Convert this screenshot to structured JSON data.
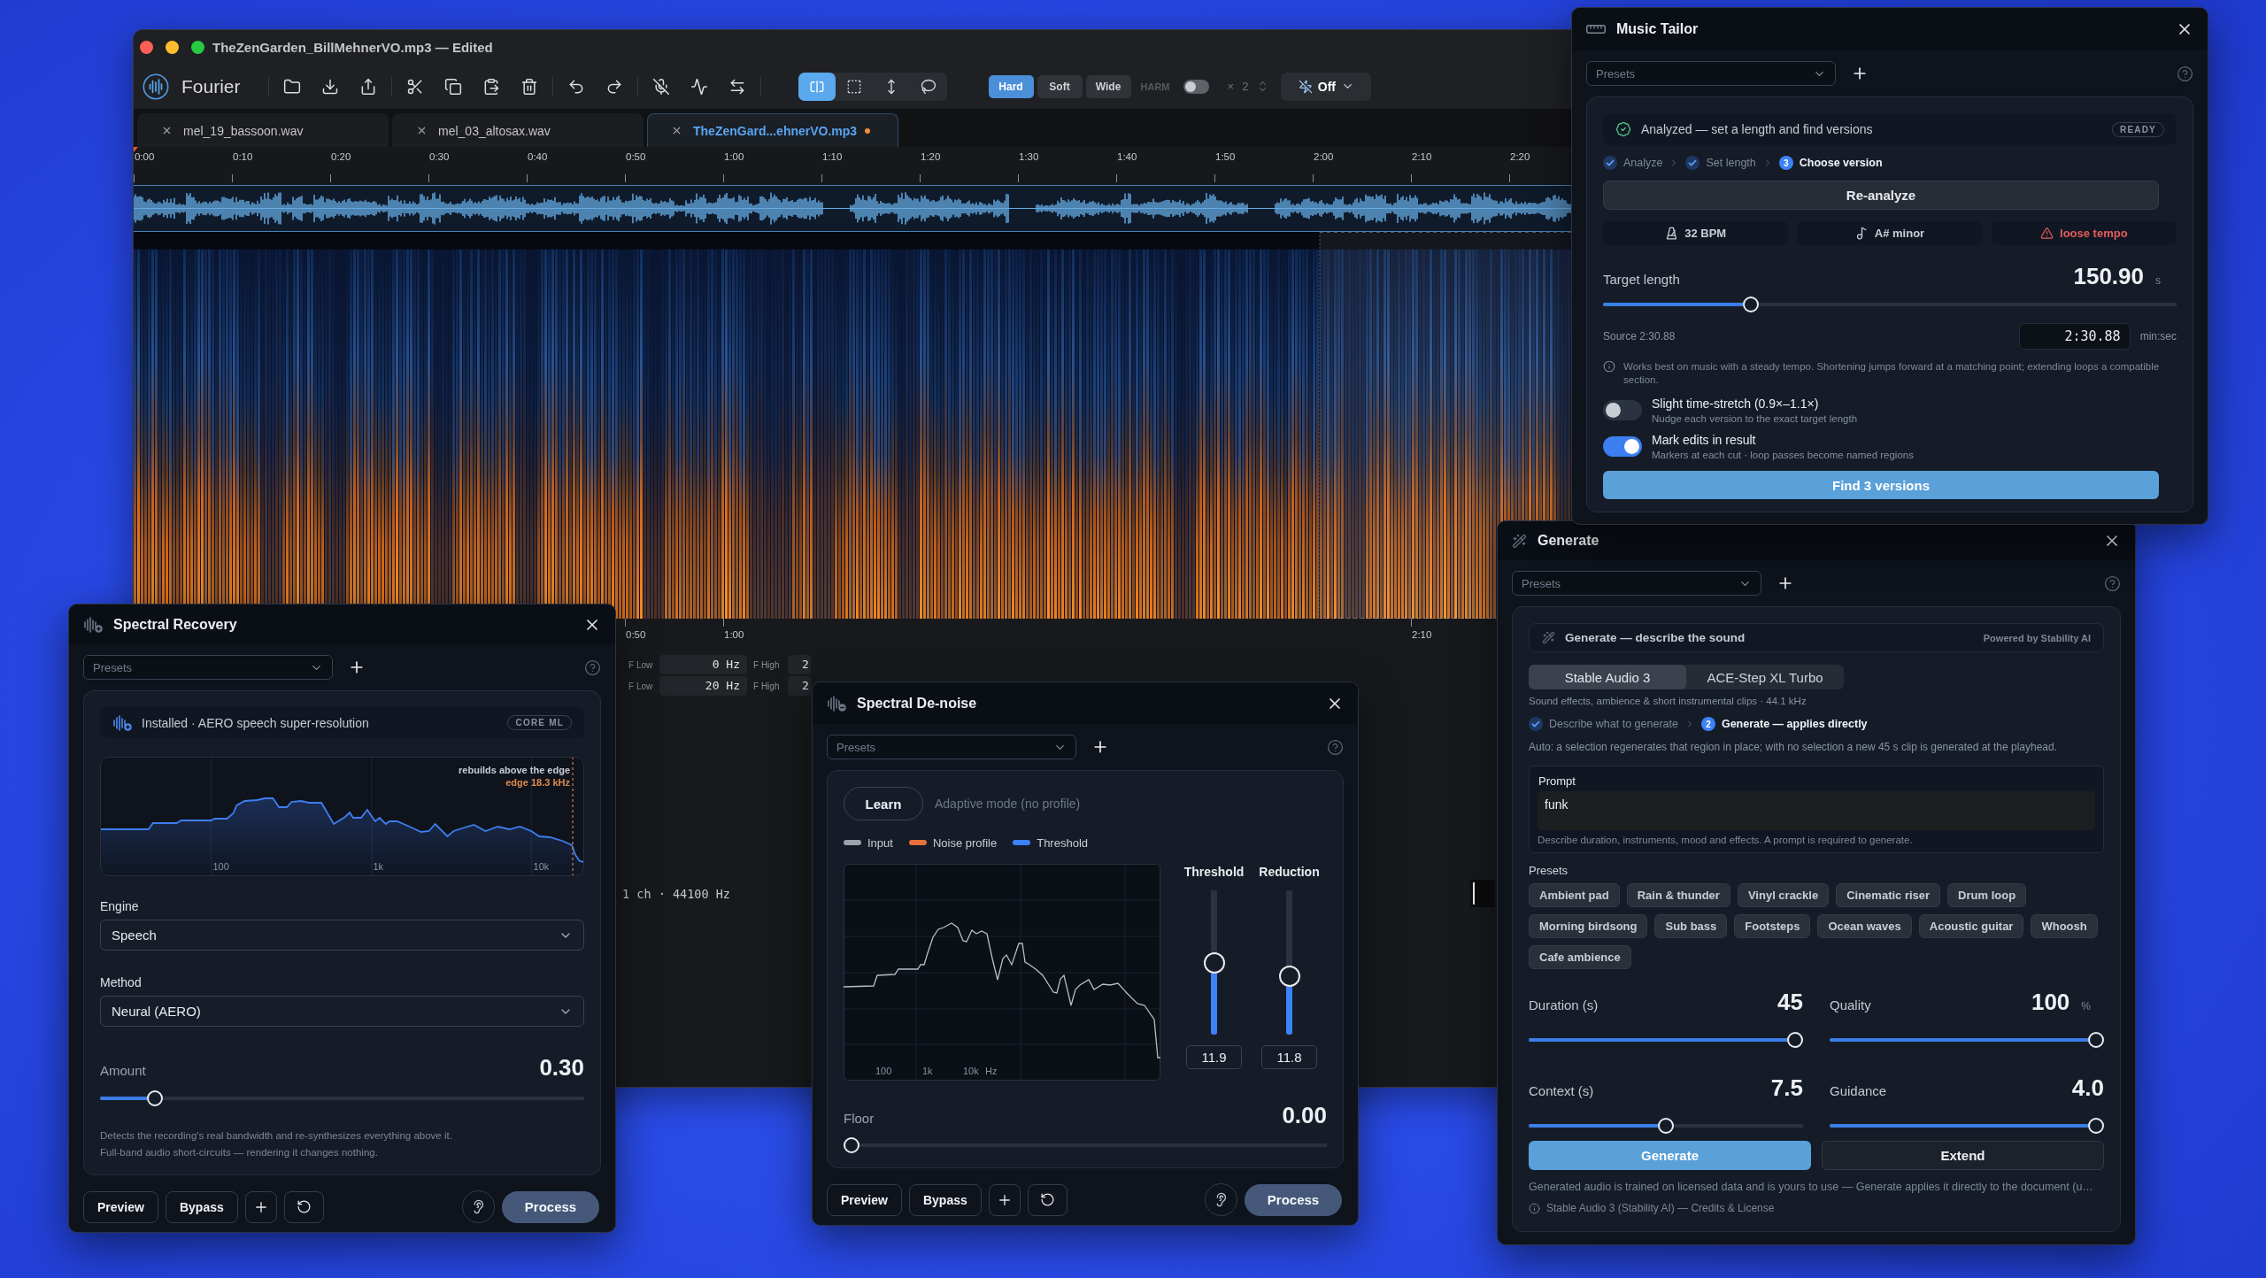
{
  "main_window": {
    "title": "TheZenGarden_BillMehnerVO.mp3 — Edited",
    "toolbar": {
      "app_name": "Fourier",
      "selection_tools": [
        {
          "kind": "range",
          "selected": true
        },
        {
          "kind": "marquee",
          "selected": false
        },
        {
          "kind": "vertical",
          "selected": false
        },
        {
          "kind": "lasso",
          "selected": false
        }
      ],
      "modes": [
        {
          "label": "Hard",
          "selected": true
        },
        {
          "label": "Soft",
          "selected": false
        },
        {
          "label": "Wide",
          "selected": false
        }
      ],
      "harm": {
        "label": "HARM",
        "on": false
      },
      "multiplier": {
        "sign": "×",
        "value": "2"
      },
      "snap": {
        "label": "Off"
      }
    },
    "tabs": [
      {
        "label": "mel_19_bassoon.wav",
        "selected": false,
        "modified": false
      },
      {
        "label": "mel_03_altosax.wav",
        "selected": false,
        "modified": false
      },
      {
        "label": "TheZenGard...ehnerVO.mp3",
        "selected": true,
        "modified": true
      }
    ],
    "ruler": [
      "0:00",
      "0:10",
      "0:20",
      "0:30",
      "0:40",
      "0:50",
      "1:00",
      "1:10",
      "1:20",
      "1:30",
      "1:40",
      "1:50",
      "2:00",
      "2:10",
      "2:20"
    ],
    "lower_ruler": {
      "left": [
        "0:50",
        "1:00"
      ],
      "right": [
        "2:10"
      ]
    },
    "filter_rows": [
      {
        "low_label": "F Low",
        "low_value": "0 Hz",
        "high_label": "F High",
        "high_value": "2"
      },
      {
        "low_label": "F Low",
        "low_value": "20 Hz",
        "high_label": "F High",
        "high_value": "2"
      }
    ],
    "status_bar": {
      "info": "1 ch · 44100 Hz"
    }
  },
  "music_tailor": {
    "title": "Music Tailor",
    "presets": {
      "placeholder": "Presets"
    },
    "status": {
      "text": "Analyzed — set a length and find versions",
      "badge": "READY"
    },
    "steps": [
      {
        "kind": "done",
        "label": "Analyze"
      },
      {
        "kind": "done",
        "label": "Set length"
      },
      {
        "kind": "current",
        "number": "3",
        "label": "Choose version"
      }
    ],
    "reanalyze_button": "Re-analyze",
    "facts": [
      {
        "kind": "tempo",
        "text": "32 BPM"
      },
      {
        "kind": "key",
        "text": "A# minor"
      },
      {
        "kind": "warning",
        "text": "loose tempo"
      }
    ],
    "target_length": {
      "label": "Target length",
      "value": "150.90",
      "unit": "s",
      "level": 0.25
    },
    "source": {
      "label": "Source 2:30.88",
      "time": "2:30.88",
      "unit": "min:sec"
    },
    "note": "Works best on music with a steady tempo. Shortening jumps forward at a matching point; extending loops a compatible section.",
    "options": [
      {
        "title": "Slight time-stretch (0.9×–1.1×)",
        "subtitle": "Nudge each version to the exact target length",
        "on": false
      },
      {
        "title": "Mark edits in result",
        "subtitle": "Markers at each cut · loop passes become named regions",
        "on": true
      }
    ],
    "find_button": "Find 3 versions"
  },
  "generate": {
    "title": "Generate",
    "presets": {
      "placeholder": "Presets"
    },
    "header": {
      "text": "Generate — describe the sound",
      "credit": "Powered by Stability AI"
    },
    "models": [
      {
        "label": "Stable Audio 3",
        "selected": true
      },
      {
        "label": "ACE-Step XL Turbo",
        "selected": false
      }
    ],
    "model_info": "Sound effects, ambience & short instrumental clips · 44.1 kHz",
    "steps": [
      {
        "kind": "done",
        "label": "Describe what to generate"
      },
      {
        "kind": "current",
        "number": "2",
        "label": "Generate — applies directly"
      }
    ],
    "auto_note": "Auto: a selection regenerates that region in place; with no selection a new 45 s clip is generated at the playhead.",
    "prompt": {
      "label": "Prompt",
      "value": "funk",
      "help": "Describe duration, instruments, mood and effects. A prompt is required to generate."
    },
    "presets_label": "Presets",
    "preset_rows": [
      [
        "Ambient pad",
        "Rain & thunder",
        "Vinyl crackle",
        "Cinematic riser",
        "Drum loop"
      ],
      [
        "Morning birdsong",
        "Sub bass",
        "Footsteps",
        "Ocean waves",
        "Acoustic guitar",
        "Whoosh"
      ],
      [
        "Cafe ambience"
      ]
    ],
    "sliders": [
      {
        "label": "Duration (s)",
        "value": "45",
        "level": 1
      },
      {
        "label": "Quality",
        "value": "100",
        "unit": "%",
        "level": 1
      },
      {
        "label": "Context (s)",
        "value": "7.5",
        "level": 0.5
      },
      {
        "label": "Guidance",
        "value": "4.0",
        "level": 1
      }
    ],
    "buttons": [
      {
        "kind": "primary",
        "label": "Generate"
      },
      {
        "kind": "secondary",
        "label": "Extend"
      }
    ],
    "disclaimer": "Generated audio is trained on licensed data and is yours to use — Generate applies it directly to the document (u…",
    "credits": "Stable Audio 3 (Stability AI) — Credits & License"
  },
  "spectral_recovery": {
    "title": "Spectral Recovery",
    "presets": {
      "placeholder": "Presets"
    },
    "status": {
      "text": "Installed · AERO speech super-resolution",
      "badge": "CORE ML"
    },
    "spectrum": {
      "note": "rebuilds above the edge",
      "edge_label": "edge 18.3 kHz",
      "axis_labels": [
        "100",
        "1k",
        "10k"
      ]
    },
    "engine": {
      "label": "Engine",
      "value": "Speech"
    },
    "method": {
      "label": "Method",
      "value": "Neural (AERO)"
    },
    "amount": {
      "label": "Amount",
      "value": "0.30",
      "level": 0.1
    },
    "description": [
      "Detects the recording's real bandwidth and re-synthesizes everything above it.",
      "Full-band audio short-circuits — rendering it changes nothing."
    ],
    "footer": {
      "buttons": [
        "Preview",
        "Bypass"
      ],
      "process": "Process"
    }
  },
  "spectral_denoise": {
    "title": "Spectral De-noise",
    "presets": {
      "placeholder": "Presets"
    },
    "learn_button": "Learn",
    "mode": "Adaptive mode (no profile)",
    "legend": [
      {
        "label": "Input",
        "color": "#9ea3ab"
      },
      {
        "label": "Noise profile",
        "color": "#e8703a"
      },
      {
        "label": "Threshold",
        "color": "#3b82f6"
      }
    ],
    "spectrum": {
      "axis_labels": [
        "100",
        "1k",
        "10k",
        "Hz"
      ]
    },
    "faders": [
      {
        "label": "Threshold",
        "value": "11.9",
        "level": 0.5
      },
      {
        "label": "Reduction",
        "value": "11.8",
        "level": 0.39
      }
    ],
    "floor": {
      "label": "Floor",
      "value": "0.00",
      "level": 0
    },
    "footer": {
      "buttons": [
        "Preview",
        "Bypass"
      ],
      "process": "Process"
    }
  }
}
